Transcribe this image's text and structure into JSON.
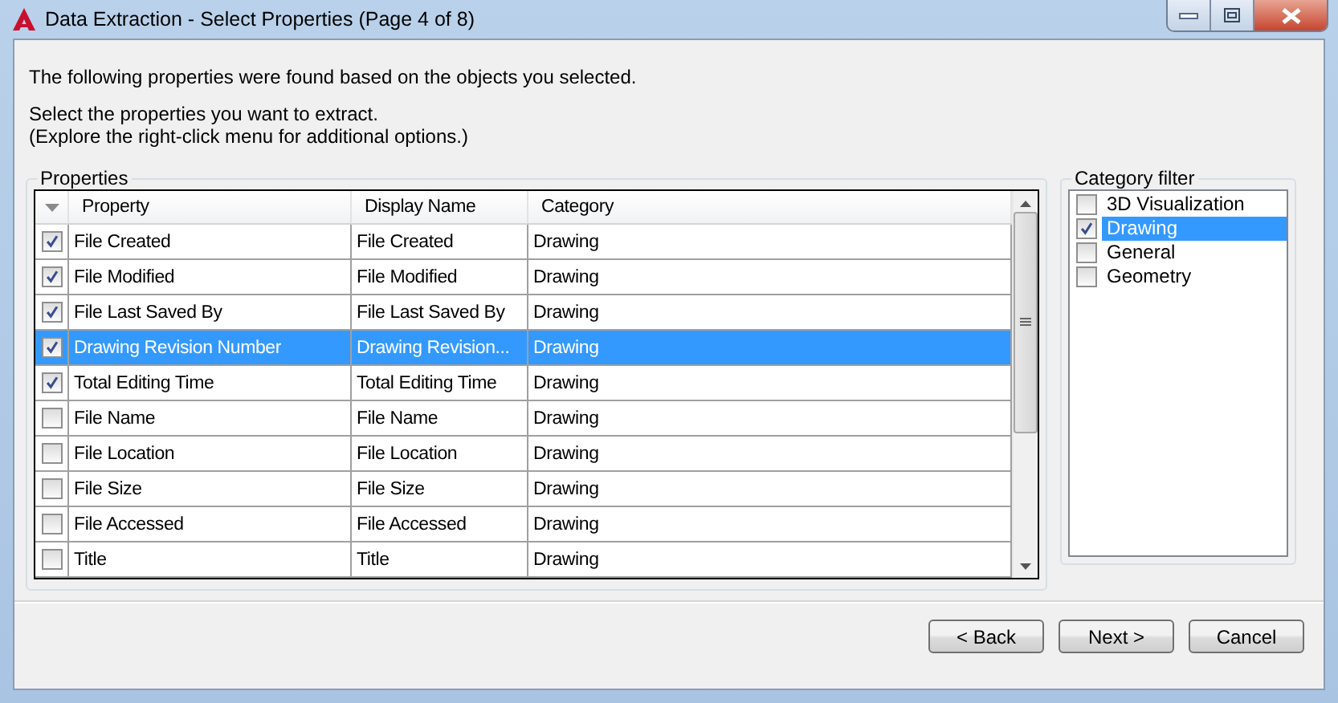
{
  "window": {
    "title": "Data Extraction - Select Properties (Page 4 of 8)"
  },
  "intro": [
    "The following properties were found based on the objects you selected.",
    "Select the properties you want to extract.",
    "(Explore the right-click menu for additional options.)"
  ],
  "properties": {
    "label": "Properties",
    "columns": [
      "Property",
      "Display Name",
      "Category"
    ],
    "rows": [
      {
        "checked": true,
        "selected": false,
        "property": "File Created",
        "display_name": "File Created",
        "category": "Drawing"
      },
      {
        "checked": true,
        "selected": false,
        "property": "File Modified",
        "display_name": "File Modified",
        "category": "Drawing"
      },
      {
        "checked": true,
        "selected": false,
        "property": "File Last Saved By",
        "display_name": "File Last Saved By",
        "category": "Drawing"
      },
      {
        "checked": true,
        "selected": true,
        "property": "Drawing Revision Number",
        "display_name": "Drawing Revision...",
        "category": "Drawing"
      },
      {
        "checked": true,
        "selected": false,
        "property": "Total Editing Time",
        "display_name": "Total Editing Time",
        "category": "Drawing"
      },
      {
        "checked": false,
        "selected": false,
        "property": "File Name",
        "display_name": "File Name",
        "category": "Drawing"
      },
      {
        "checked": false,
        "selected": false,
        "property": "File Location",
        "display_name": "File Location",
        "category": "Drawing"
      },
      {
        "checked": false,
        "selected": false,
        "property": "File Size",
        "display_name": "File Size",
        "category": "Drawing"
      },
      {
        "checked": false,
        "selected": false,
        "property": "File Accessed",
        "display_name": "File Accessed",
        "category": "Drawing"
      },
      {
        "checked": false,
        "selected": false,
        "property": "Title",
        "display_name": "Title",
        "category": "Drawing"
      }
    ]
  },
  "category_filter": {
    "label": "Category filter",
    "items": [
      {
        "label": "3D Visualization",
        "checked": false,
        "selected": false
      },
      {
        "label": "Drawing",
        "checked": true,
        "selected": true
      },
      {
        "label": "General",
        "checked": false,
        "selected": false
      },
      {
        "label": "Geometry",
        "checked": false,
        "selected": false
      }
    ]
  },
  "buttons": [
    "< Back",
    "Next >",
    "Cancel"
  ]
}
